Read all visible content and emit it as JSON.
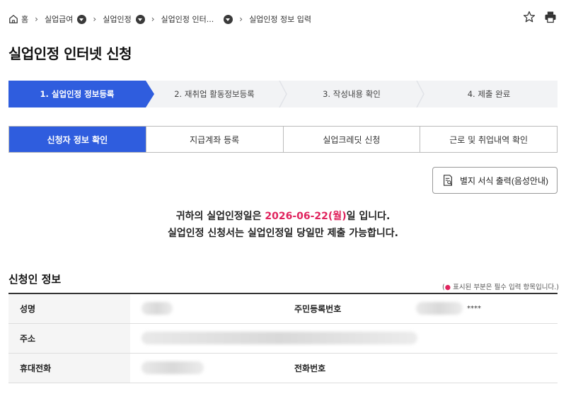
{
  "breadcrumb": {
    "home": "홈",
    "items": [
      "실업급여",
      "실업인정",
      "실업인정 인터...",
      "실업인정 정보 입력"
    ]
  },
  "icons": {
    "home": "home-icon",
    "favorite": "star-icon",
    "print": "printer-icon",
    "form": "document-search-icon"
  },
  "page_title": "실업인정 인터넷 신청",
  "steps": [
    {
      "label": "1. 실업인정 정보등록",
      "active": true
    },
    {
      "label": "2. 재취업 활동정보등록",
      "active": false
    },
    {
      "label": "3. 작성내용 확인",
      "active": false
    },
    {
      "label": "4. 제출 완료",
      "active": false
    }
  ],
  "tabs": [
    {
      "label": "신청자 정보 확인",
      "active": true
    },
    {
      "label": "지급계좌 등록",
      "active": false
    },
    {
      "label": "실업크레딧 신청",
      "active": false
    },
    {
      "label": "근로 및 취업내역 확인",
      "active": false
    }
  ],
  "print_button": {
    "label": "별지 서식 출력(음성안내)"
  },
  "notice": {
    "line1_prefix": "귀하의 실업인정일은 ",
    "date": "2026-06-22(월)",
    "line1_suffix": "일 입니다.",
    "line2": "실업인정 신청서는 실업인정일 당일만 제출 가능합니다."
  },
  "section": {
    "title": "신청인 정보",
    "required_note_prefix": "(",
    "required_note_dot": "●",
    "required_note_text": " 표시된 부분은 필수 입력 항목입니다.)"
  },
  "fields": {
    "name_label": "성명",
    "rrn_label": "주민등록번호",
    "rrn_mask": "****",
    "address_label": "주소",
    "mobile_label": "휴대전화",
    "phone_label": "전화번호"
  },
  "colors": {
    "primary": "#2f5dde",
    "accent": "#e0245e",
    "step_bg": "#f2f3f5"
  }
}
